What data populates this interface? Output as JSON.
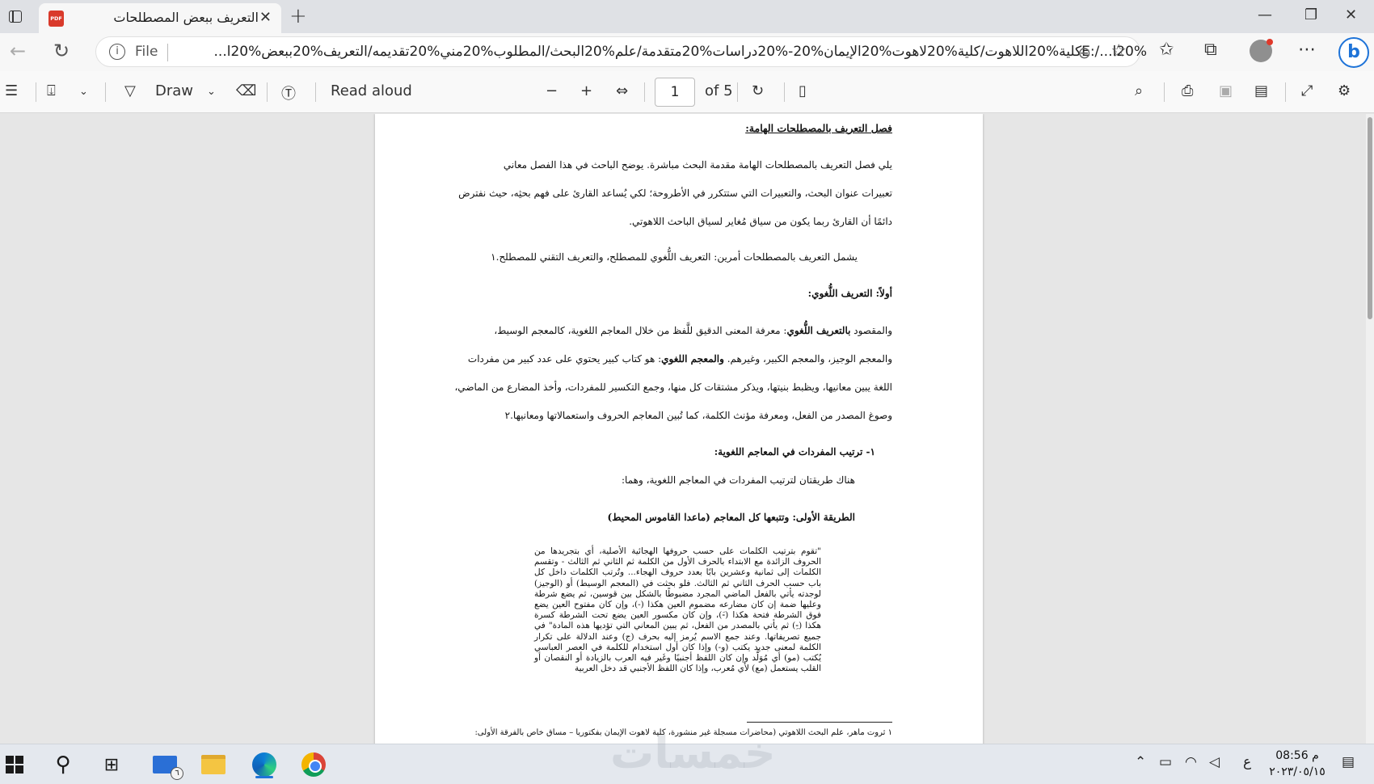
{
  "browser": {
    "tab_title": "التعريف ببعض المصطلحات الهامة",
    "tab_icon_label": "PDF",
    "url_scheme": "File",
    "url": "E:/...l20%كلية%20اللاهوت/كلية%20لاهوت%20الإيمان%20-%20دراسات%20متقدمة/علم%20البحث/المطلوب%20مني%20تقديمه/التعريف%20ببعض%20ا..."
  },
  "pdf_toolbar": {
    "draw_label": "Draw",
    "read_aloud_label": "Read aloud",
    "page_number": "1",
    "page_total": "of 5"
  },
  "document": {
    "heading": "فصل التعريف بالمصطلحات الهامة:",
    "para1_lines": [
      "يلي فصل التعريف بالمصطلحات الهامة مقدمة البحث مباشرة. يوضح الباحث في هذا الفصل معاني",
      "تعبيرات عنوان البحث، والتعبيرات التي ستتكرر في الأطروحة؛ لكي يُساعد القارئ على فهم بحثِه، حيث نفترض",
      "دائمًا أن القارئ ربما يكون من سياق مُغاير لسياق الباحث اللاهوتي."
    ],
    "para2": "يشمل التعريف بالمصطلحات أمرين: التعريف اللُّغوي للمصطلح، والتعريف التقني للمصطلح.١",
    "section1_title": "أولاً: التعريف اللُّغوي:",
    "para3_line1_pre": "والمقصود ",
    "para3_line1_bold": "بالتعريف اللُّغوي",
    "para3_line1_post": ": معرفة المعنى الدقيق للَّفظ من خلال المعاجم اللغوية، كالمعجم الوسيط،",
    "para3_line2_pre": "والمعجم الوجيز، والمعجم الكبير، وغيرهم. ",
    "para3_line2_bold": "والمعجم اللغوي",
    "para3_line2_post": ": هو كتاب كبير يحتوي على عدد كبير من مفردات",
    "para3_line3": "اللغة يبين معانيها، ويظبط بنيتها، ويذكر مشتقات كل منها، وجمع التكسير للمفردات، وأخذ المضارع من الماضي،",
    "para3_line4": "وصوغ المصدر من الفعل، ومعرفة مؤنث الكلمة، كما تُبين المعاجم الحروف واستعمالاتها ومعانيها.٢",
    "sub1_title": "١-  ترتيب المفردات في المعاجم اللغوية:",
    "sub1_text": "هناك طريقتان لترتيب المفردات في المعاجم اللغوية، وهما:",
    "method1_title": "الطريقة الأولى: وتتبعها كل المعاجم (ماعدا القاموس المحيط)",
    "quote": "\"تقوم بترتيب الكلمات على حسب حروفها الهجائية الأصلية، أي بتجريدها من الحروف الزائدة مع الابتداء بالحرف الأول من الكلمة ثم الثاني ثم الثالث - وتقسم الكلمات إلى ثمانية وعشرين بابًا بعدد حروف الهجاء... وتُرتب الكلمات داخل كل باب حسب الحرف الثاني ثم الثالث. فلو بحثت في (المعجم الوسيط) أو (الوجيز) لوجدته يأتي بالفعل الماضي المجرد مضبوطًا بالشكل بين قوسين، ثم يضع شرطة وعليها ضمة إن كان مضارعه مضموم العين هكذا (-)، وإن كان مفتوح العين يضع فوق الشرطة فتحة هكذا (-َ)، وإن كان مكسور العين يضع تحت الشرطة كسرة هكذا (-ِ) ثم يأتي بالمصدر من الفعل، ثم يبين المعاني التي تؤديها هذه المادة\" في جميع تصريفاتها. وعند جمع الاسم يُرمز إليه بحرف (ج) وعند الدلالة على تكرار الكلمة لمعنى جديد يكتب (و-) وإذا كان أول استخدام للكلمة في العصر العباسي يُكتب (مو) أي مُوَلَّد وإن كان اللفظ أجنبيًا وغَير فيه العرب بالزيادة أو النقصان أو القلب يستعمل (مع) لأي مُعرب، وإذا كان اللفظ الأجنبي قد دخل العربية",
    "footnote": "١ ثروت ماهر، علم البحث اللاهوتي (محاضرات مسجلة غير منشورة، كلية لاهوت الإيمان بفكتوريا – مساق خاص بالفرقة الأولى:"
  },
  "taskbar": {
    "mail_badge": "٦",
    "lang_indicator": "ع",
    "time": "08:56 م",
    "date": "٢٠٢٣/٠٥/١٥"
  },
  "watermark": "خمسات"
}
